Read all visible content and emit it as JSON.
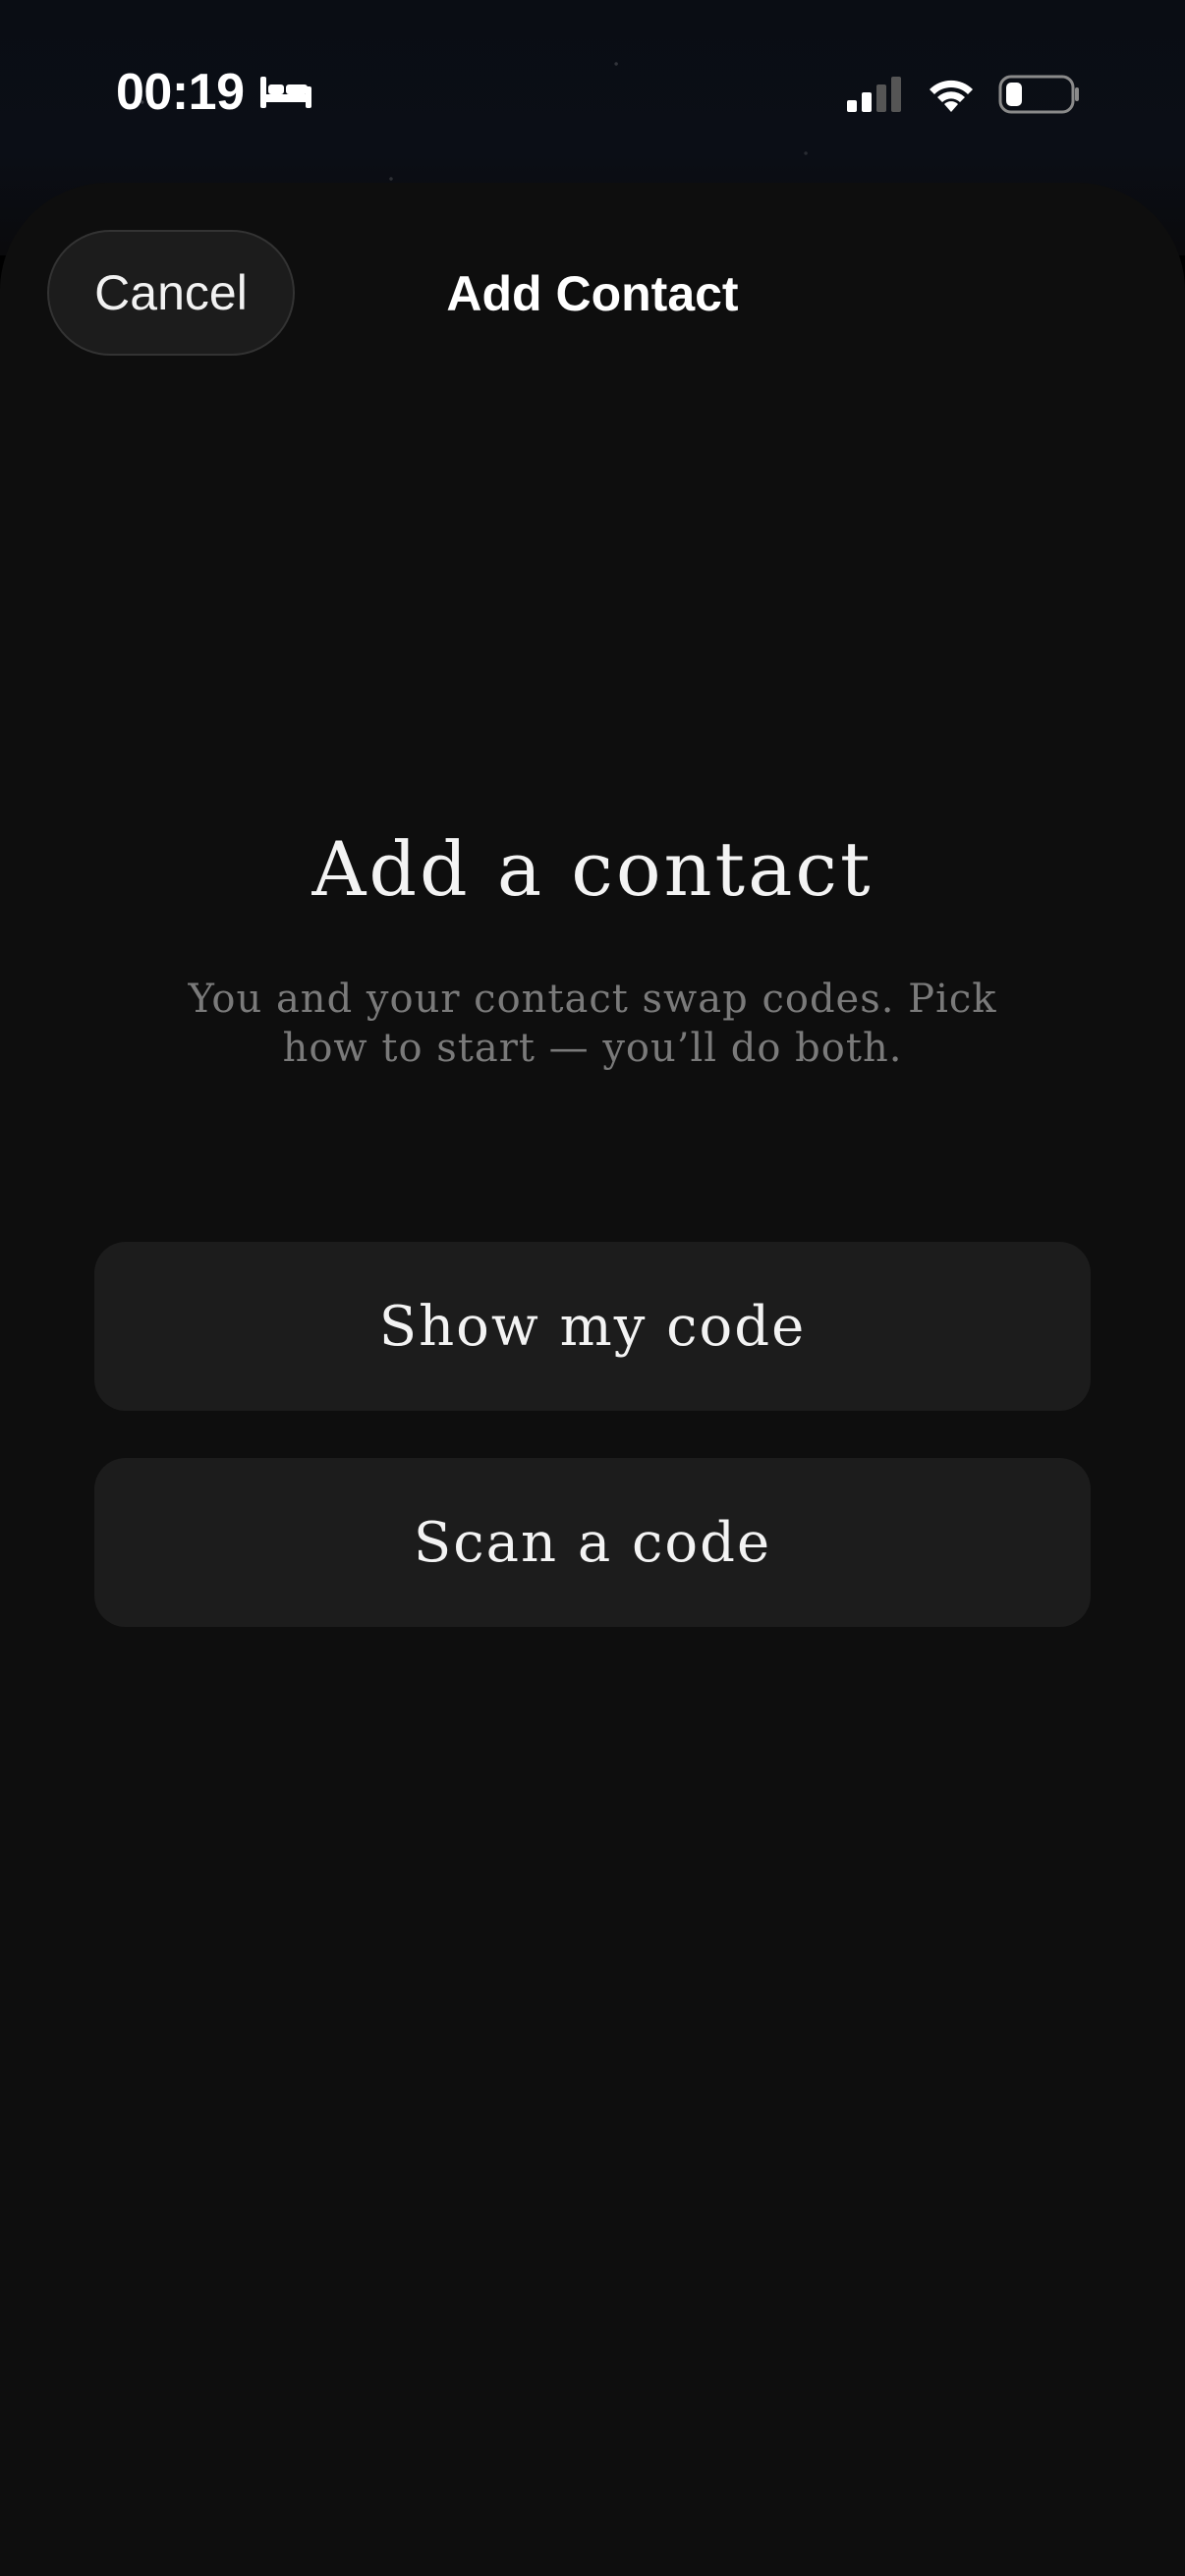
{
  "status_bar": {
    "time": "00:19",
    "icons": [
      "bed-icon",
      "cellular-signal-icon",
      "wifi-icon",
      "battery-icon"
    ]
  },
  "nav": {
    "cancel_label": "Cancel",
    "title": "Add Contact"
  },
  "main": {
    "headline": "Add a contact",
    "subtitle": "You and your contact swap codes. Pick how to start — you’ll do both.",
    "buttons": [
      {
        "label": "Show my code"
      },
      {
        "label": "Scan a code"
      }
    ]
  },
  "colors": {
    "sheet_background": "#0e0e0e",
    "button_background": "#1c1c1c",
    "subtitle_text": "#7a7a7a",
    "primary_text": "#f3f3f3"
  }
}
